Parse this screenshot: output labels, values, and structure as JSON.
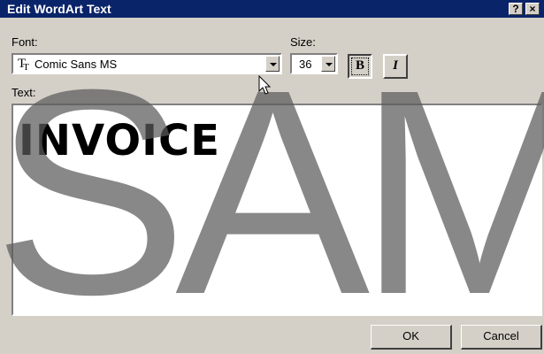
{
  "dialog": {
    "title": "Edit WordArt Text",
    "help_label": "?",
    "close_label": "×"
  },
  "font": {
    "label": "Font:",
    "value": "Comic Sans MS"
  },
  "size": {
    "label": "Size:",
    "value": "36"
  },
  "style": {
    "bold_label": "B",
    "italic_label": "I",
    "bold_active": true
  },
  "text": {
    "label": "Text:",
    "value": "INVOICE"
  },
  "buttons": {
    "ok": "OK",
    "cancel": "Cancel"
  },
  "watermark": "SAM"
}
